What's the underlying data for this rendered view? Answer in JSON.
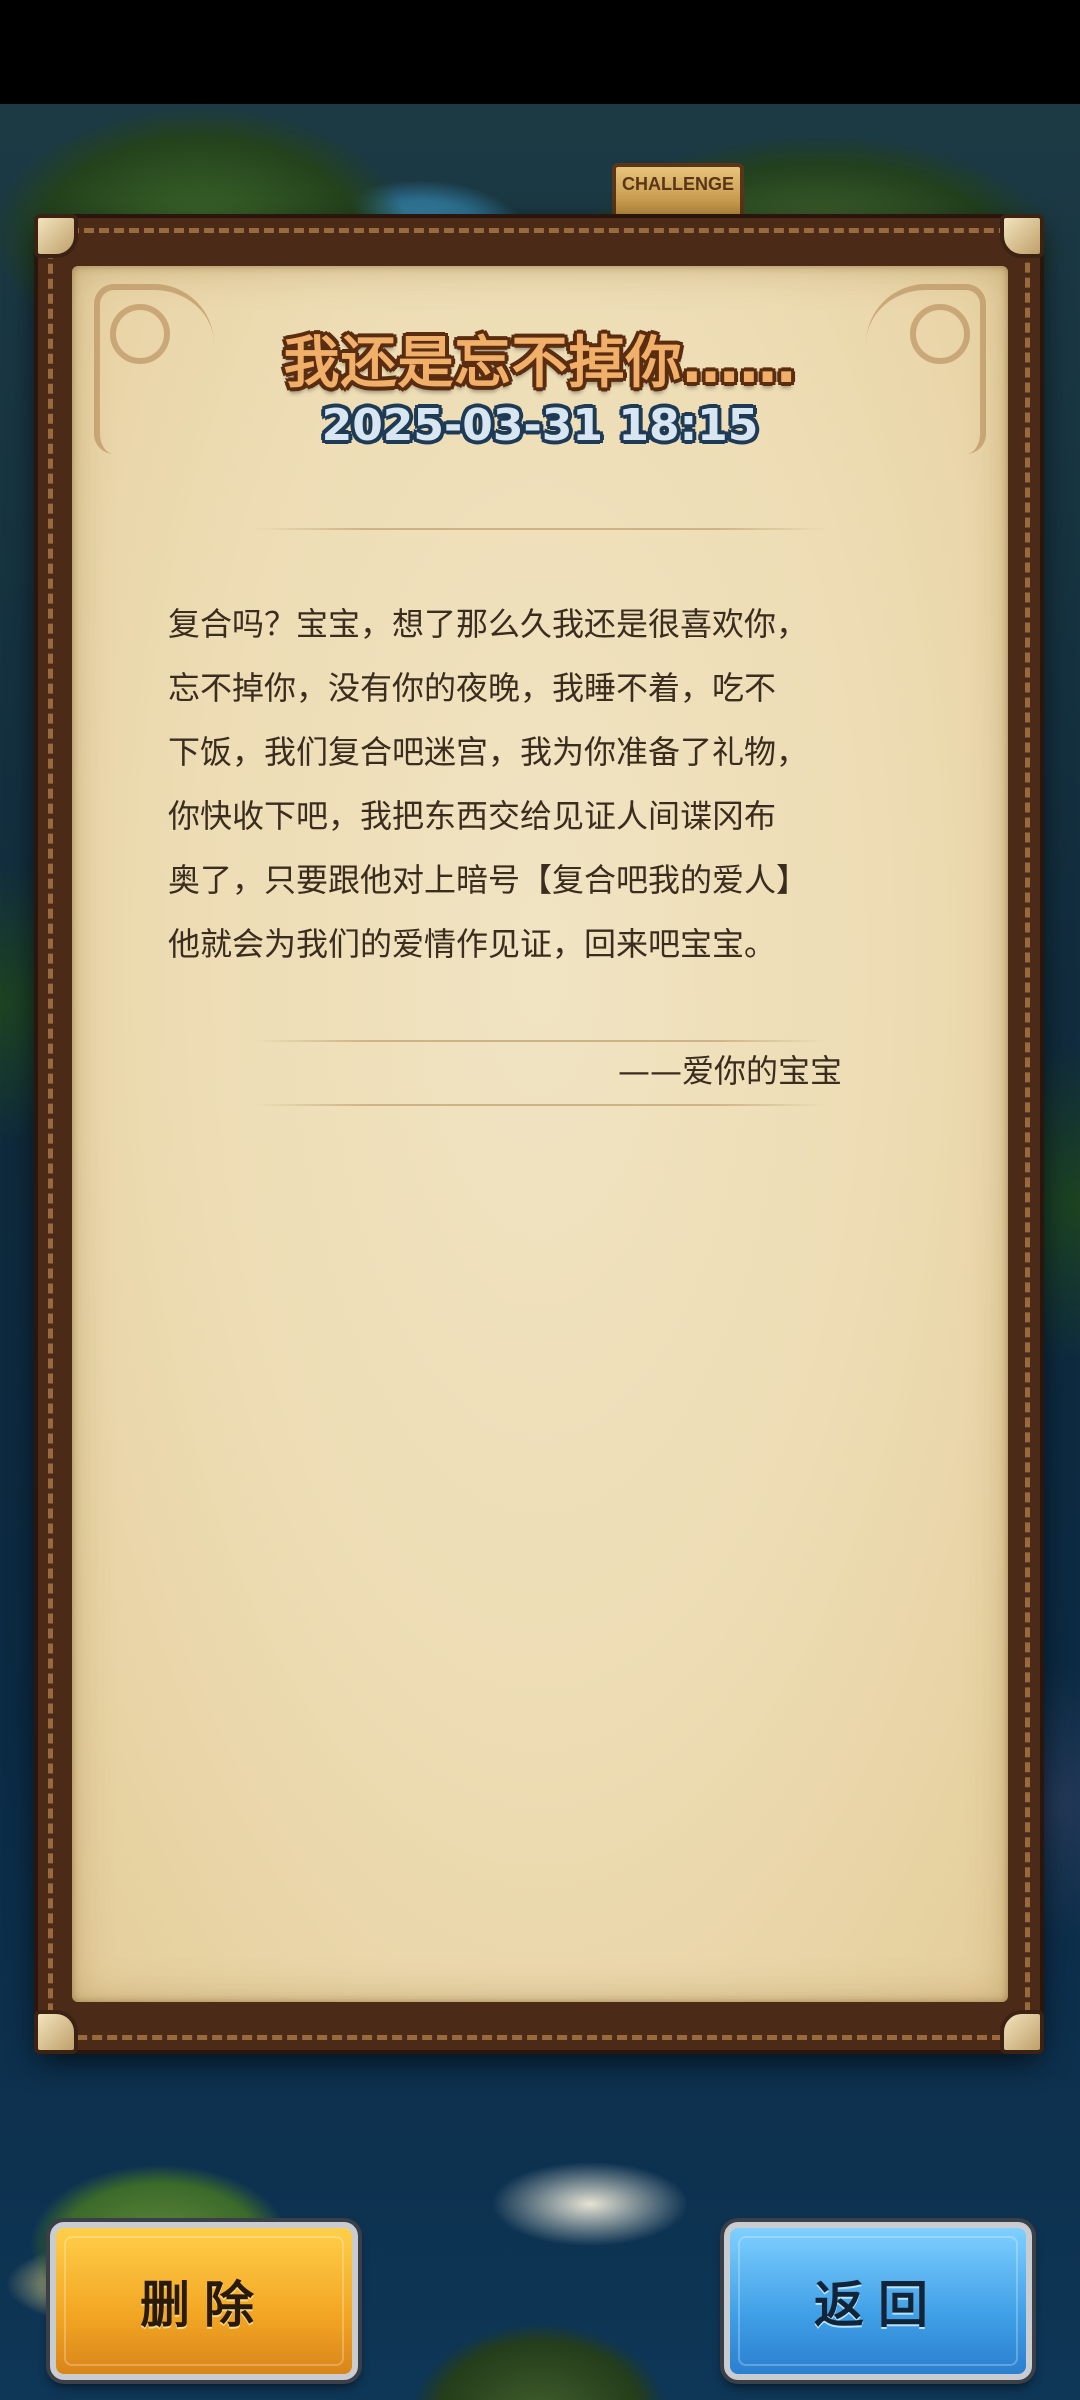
{
  "map": {
    "challenge_sign": "CHALLENGE"
  },
  "letter": {
    "title": "我还是忘不掉你……",
    "datetime": "2025-03-31 18:15",
    "body_lines": [
      "复合吗？宝宝，想了那么久我还是很喜欢你，",
      "忘不掉你，没有你的夜晚，我睡不着，吃不",
      "下饭，我们复合吧迷宫，我为你准备了礼物，",
      "你快收下吧，我把东西交给见证人间谍冈布",
      "奥了，只要跟他对上暗号【复合吧我的爱人】",
      "他就会为我们的爱情作见证，回来吧宝宝。"
    ],
    "signature": "——爱你的宝宝"
  },
  "buttons": {
    "delete_label": "删除",
    "back_label": "返回"
  },
  "colors": {
    "title": "#f0b06a",
    "title_outline": "#5a2c10",
    "datetime": "#d7e6f1",
    "paper": "#eddcb3",
    "frame": "#4b2a18",
    "delete_button": "#f2a623",
    "back_button": "#3f9fe6"
  }
}
